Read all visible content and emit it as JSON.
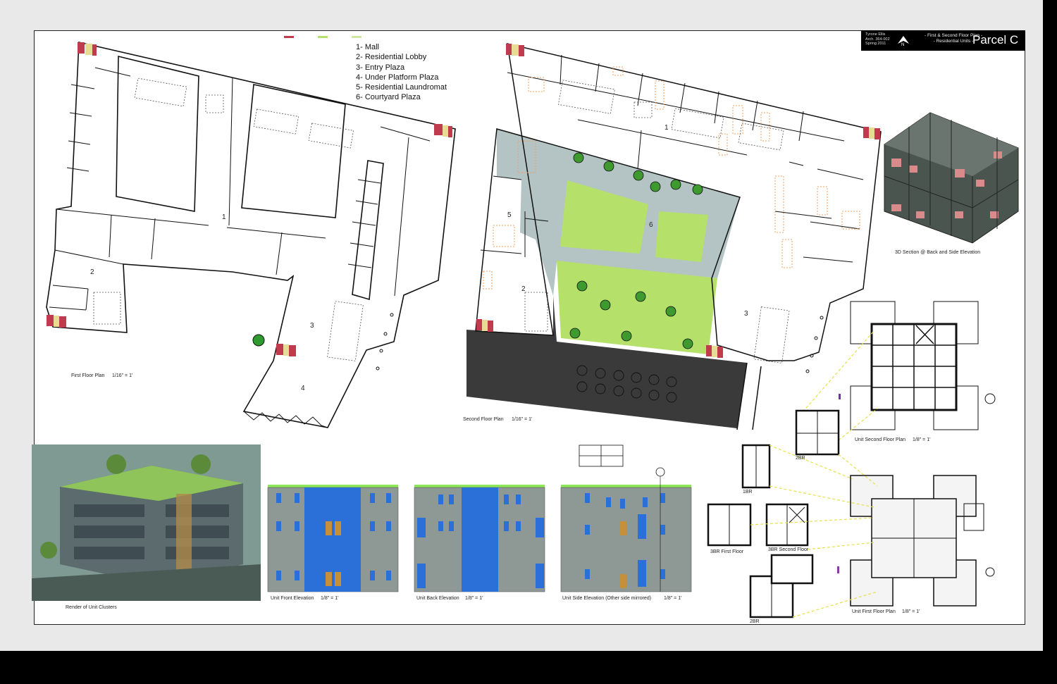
{
  "title_block": {
    "author_lines": [
      "Tyrone Ellis",
      "Arch. 364-002",
      "Spring 2011"
    ],
    "subtitle_lines": [
      "- First & Second Floor Plan -",
      "- Residential Units -"
    ],
    "parcel": "Parcel C"
  },
  "program_legend": [
    "1- Mall",
    "2- Residential Lobby",
    "3- Entry Plaza",
    "4- Under Platform Plaza",
    "5- Residential Laundromat",
    "6- Courtyard Plaza"
  ],
  "plan_numbers": {
    "first": [
      "1",
      "2",
      "3",
      "4"
    ],
    "second": [
      "1",
      "2",
      "3",
      "5",
      "6"
    ]
  },
  "captions": {
    "first_floor": "First Floor Plan",
    "first_floor_scale": "1/16\" = 1'",
    "second_floor": "Second Floor Plan",
    "second_floor_scale": "1/16\" = 1'",
    "section_3d": "3D Section @ Back and Side Elevation",
    "unit_second_floor": "Unit Second Floor Plan",
    "unit_second_floor_scale": "1/8\" = 1'",
    "unit_first_floor": "Unit First Floor Plan",
    "unit_first_floor_scale": "1/8\" = 1'",
    "render": "Render of Unit Clusters",
    "front_elev": "Unit Front Elevation",
    "front_elev_scale": "1/8\" = 1'",
    "back_elev": "Unit Back Elevation",
    "back_elev_scale": "1/8\" = 1'",
    "side_elev": "Unit Side Elevation (Other side mirrored)",
    "side_elev_scale": "1/8\" = 1'",
    "unit_1br": "1BR",
    "unit_2br_top": "2BR",
    "unit_2br_bottom": "2BR",
    "unit_3br_first": "3BR First Floor",
    "unit_3br_second": "3BR Second Floor"
  },
  "colors": {
    "sheet": "#ffffff",
    "border_gray": "#e9e9e9",
    "courtyard_gray": "#b4c4c4",
    "lawn_green": "#b5e06a",
    "elevation_gray": "#8e9894",
    "glass_blue": "#2b6fd8",
    "roof_green": "#8ee85a",
    "stair_red": "#c03b4d",
    "stair_yellow": "#e8dc95",
    "hatch_dark": "#3a3a3a",
    "orange_furniture": "#f0a060"
  }
}
